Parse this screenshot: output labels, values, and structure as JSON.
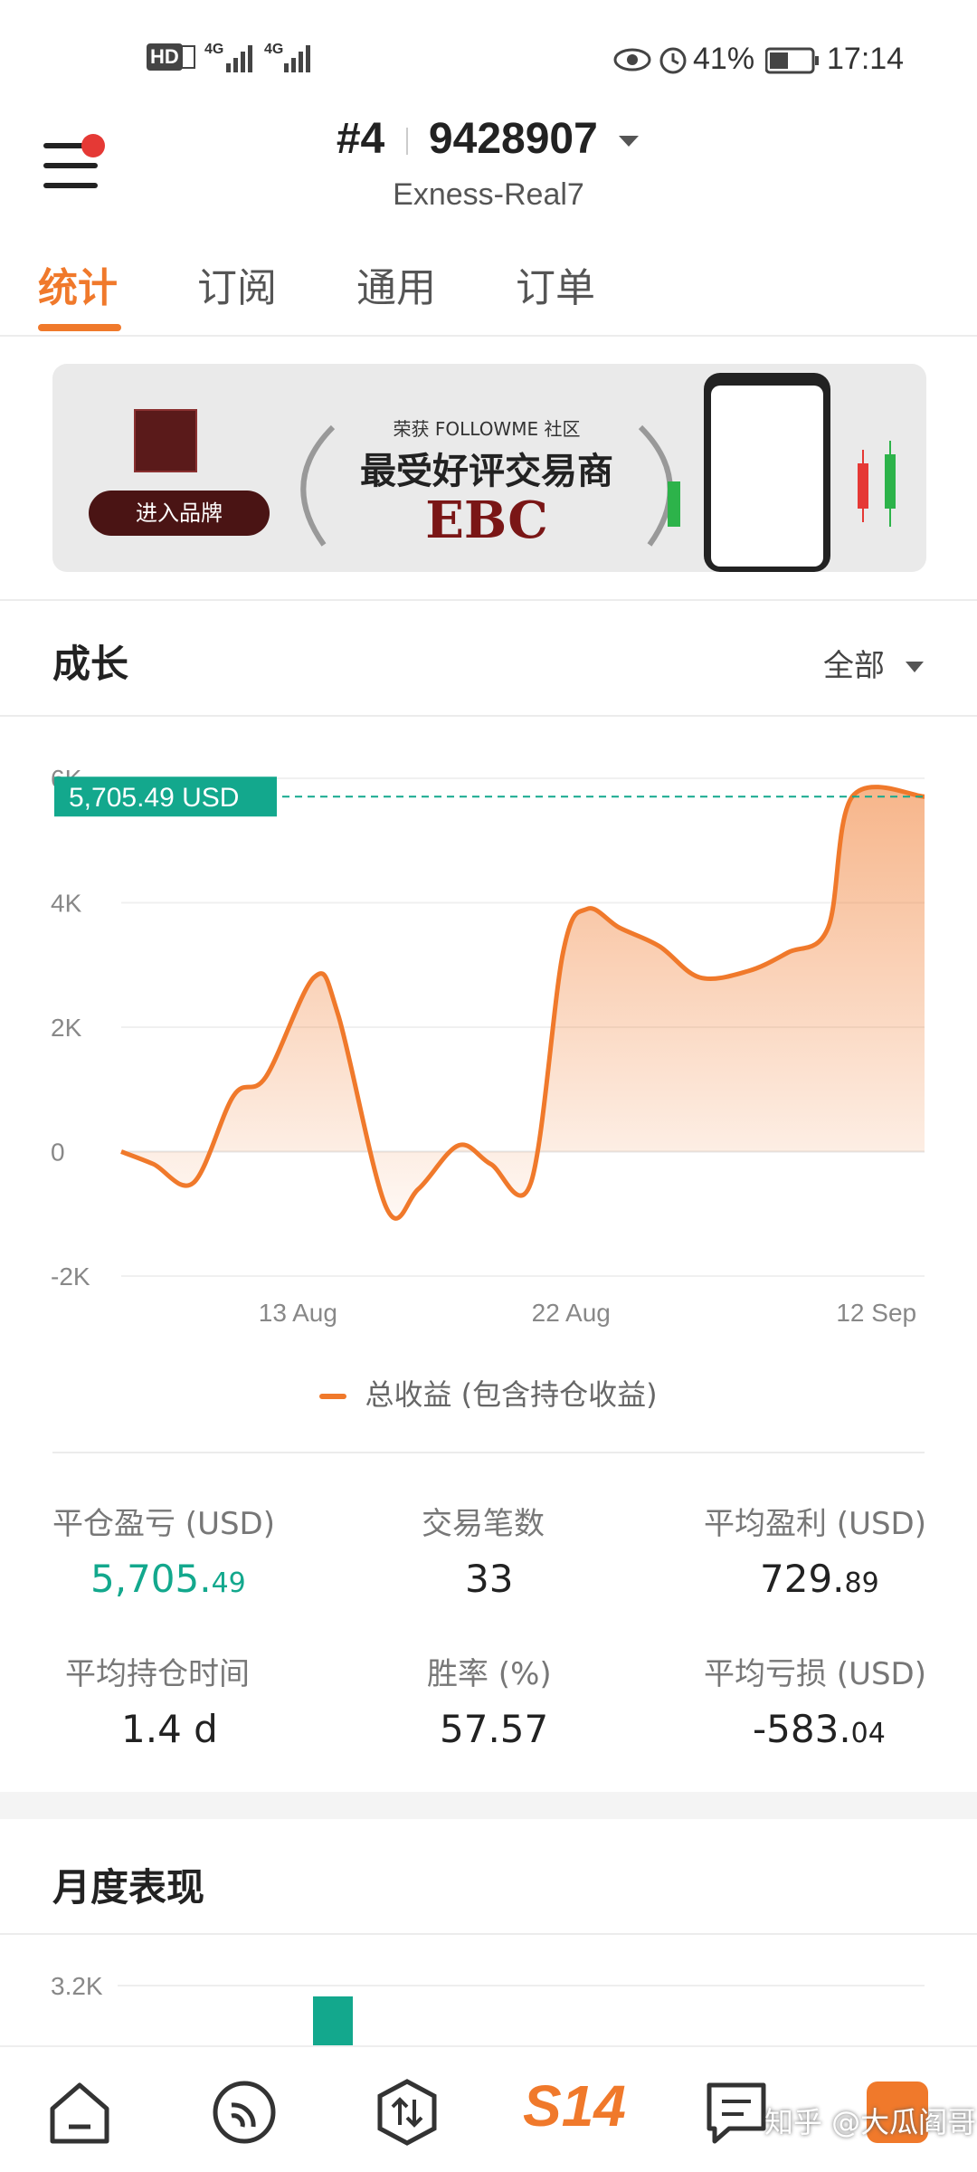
{
  "status_bar": {
    "network_left": "HD",
    "signal_1": "4G",
    "signal_2": "4G",
    "battery_pct": "41%",
    "time": "17:14"
  },
  "header": {
    "account_rank": "#4",
    "account_id": "9428907",
    "account_server": "Exness-Real7"
  },
  "tabs": [
    {
      "label": "统计",
      "active": true
    },
    {
      "label": "订阅",
      "active": false
    },
    {
      "label": "通用",
      "active": false
    },
    {
      "label": "订单",
      "active": false
    }
  ],
  "banner": {
    "brand_button": "进入品牌",
    "kicker": "荣获 FOLLOWME 社区",
    "headline": "最受好评交易商",
    "brand": "EBC"
  },
  "growth": {
    "title": "成长",
    "range": "全部",
    "legend": "总收益 (包含持仓收益)"
  },
  "chart_data": {
    "type": "area",
    "title": "成长",
    "ylabel": "",
    "xlabel": "",
    "ylim": [
      -2000,
      6000
    ],
    "y_ticks": [
      "6K",
      "4K",
      "2K",
      "0",
      "-2K"
    ],
    "x_tick_labels": [
      "13 Aug",
      "22 Aug",
      "12 Sep"
    ],
    "current_value_label": "5,705.49 USD",
    "current_value": 5705.49,
    "series": [
      {
        "name": "总收益 (包含持仓收益)",
        "color": "#f0792b",
        "points": [
          [
            0.0,
            0
          ],
          [
            0.04,
            -200
          ],
          [
            0.09,
            -500
          ],
          [
            0.14,
            900
          ],
          [
            0.18,
            1200
          ],
          [
            0.24,
            2800
          ],
          [
            0.27,
            2200
          ],
          [
            0.33,
            -900
          ],
          [
            0.37,
            -600
          ],
          [
            0.42,
            100
          ],
          [
            0.46,
            -200
          ],
          [
            0.51,
            -500
          ],
          [
            0.55,
            3200
          ],
          [
            0.58,
            3900
          ],
          [
            0.62,
            3600
          ],
          [
            0.67,
            3300
          ],
          [
            0.72,
            2800
          ],
          [
            0.78,
            2900
          ],
          [
            0.83,
            3200
          ],
          [
            0.88,
            3600
          ],
          [
            0.91,
            5705
          ],
          [
            1.0,
            5705
          ]
        ]
      }
    ]
  },
  "stats": {
    "closed_pnl_label": "平仓盈亏 (USD)",
    "closed_pnl_int": "5,705.",
    "closed_pnl_dec": "49",
    "trades_label": "交易笔数",
    "trades_value": "33",
    "avg_profit_label": "平均盈利 (USD)",
    "avg_profit_int": "729.",
    "avg_profit_dec": "89",
    "avg_hold_label": "平均持仓时间",
    "avg_hold_value": "1.4 d",
    "win_rate_label": "胜率 (%)",
    "win_rate_value": "57.57",
    "avg_loss_label": "平均亏损 (USD)",
    "avg_loss_int": "-583.",
    "avg_loss_dec": "04"
  },
  "monthly": {
    "title": "月度表现",
    "y_tick": "3.2K"
  },
  "bottom_nav": {
    "center_label": "S14",
    "watermark": "知乎 @大瓜阎哥"
  },
  "colors": {
    "accent": "#f0792b",
    "green": "#13a88d"
  }
}
